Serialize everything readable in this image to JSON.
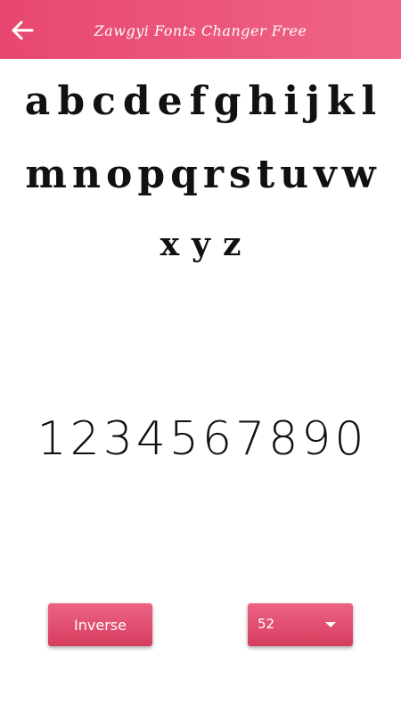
{
  "appbar": {
    "title": "Zawgyi Fonts Changer Free",
    "back_icon": "arrow-left-icon",
    "color": "#ec5a7c"
  },
  "preview": {
    "row1": [
      "a",
      "b",
      "c",
      "d",
      "e",
      "f",
      "g",
      "h",
      "i",
      "j",
      "k",
      "l"
    ],
    "row2": [
      "m",
      "n",
      "o",
      "p",
      "q",
      "r",
      "s",
      "t",
      "u",
      "v",
      "w"
    ],
    "row3": [
      "x",
      "y",
      "z"
    ],
    "digits": [
      "1",
      "2",
      "3",
      "4",
      "5",
      "6",
      "7",
      "8",
      "9",
      "0"
    ]
  },
  "controls": {
    "inverse_label": "Inverse",
    "size_value": "52",
    "dropdown_icon": "caret-down-icon",
    "button_color": "#e04c6e"
  }
}
